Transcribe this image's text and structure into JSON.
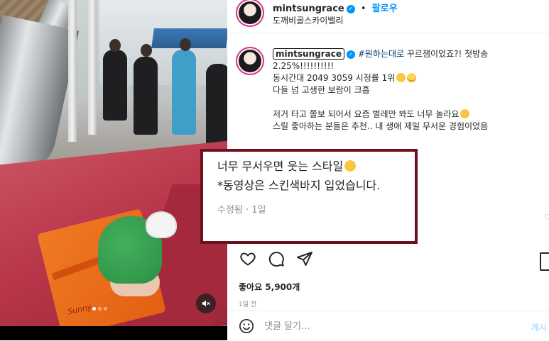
{
  "post": {
    "username": "mintsungrace",
    "follow_label": "팔로우",
    "separator": "•",
    "location": "도깨비골스카이밸리"
  },
  "caption": {
    "username": "mintsungrace",
    "hashtag": "#원하는대로",
    "line1_rest": " 꾸르잼이었죠?! 첫방송",
    "line2": "2.25%!!!!!!!!!!",
    "line3": "동시간대 2049 3059 시청률 1위",
    "line4": "다들 넘 고생한 보람이 크흡",
    "line5": "저거 타고 쫄보 되어서 요즘 벌레만 봐도 너무 놀라요",
    "line6": "스릴 좋아하는 분들은 추천.. 내 생애 제일 무서운 경험이었음"
  },
  "overlay": {
    "line1": "너무 무서우면 웃는 스타일",
    "line2": "*동영상은 스킨색바지 입었습니다.",
    "meta": "수정됨 · 1일"
  },
  "media": {
    "brand_text": "Sunny"
  },
  "engagement": {
    "likes": "좋아요 5,900개",
    "time_ago": "1일 전"
  },
  "comment": {
    "placeholder": "댓글 달기...",
    "post_label": "게시"
  },
  "icons": {
    "like": "heart-icon",
    "comment": "comment-icon",
    "share": "share-icon",
    "mute": "muted-speaker-icon",
    "emoji": "emoji-icon",
    "verified": "verified-badge-icon"
  },
  "colors": {
    "link": "#0095f6",
    "hashtag": "#00376b",
    "overlay_border": "#6e1020",
    "story_ring": "#dc2f87"
  }
}
